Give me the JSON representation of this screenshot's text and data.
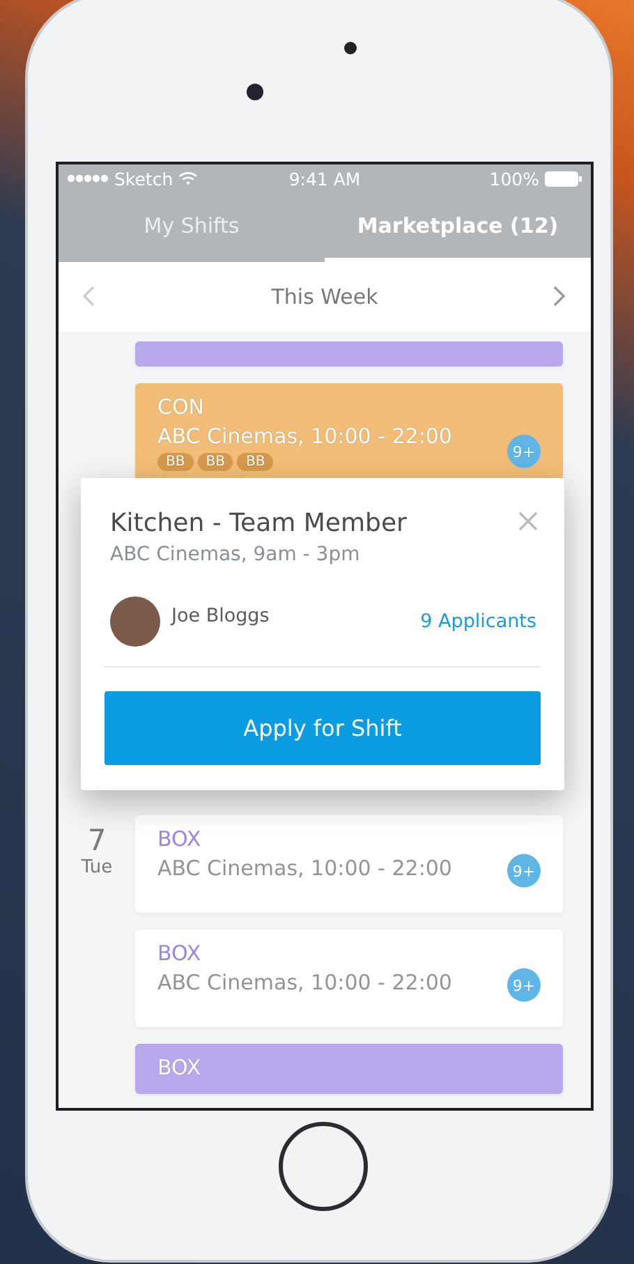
{
  "status_bar": {
    "carrier": "Sketch",
    "time": "9:41 AM",
    "battery": "100%"
  },
  "tabs": [
    {
      "label": "My Shifts",
      "selected": false
    },
    {
      "label": "Marketplace (12)",
      "selected": true
    }
  ],
  "week_header": {
    "title": "This Week"
  },
  "days": [
    {
      "shifts": [
        {
          "kind": "striped",
          "color": "#b9a9ec"
        },
        {
          "kind": "striped",
          "color": "#f2bd78",
          "code": "CON",
          "place_time": "ABC Cinemas, 10:00 - 22:00",
          "badge": "9+",
          "tags": [
            "BB",
            "BB",
            "BB"
          ]
        }
      ]
    },
    {
      "day": "7",
      "weekday": "Tue",
      "shifts": [
        {
          "kind": "plain",
          "color": "#9c88e2",
          "code": "BOX",
          "place_time": "ABC Cinemas, 10:00 - 22:00",
          "badge": "9+"
        },
        {
          "kind": "plain",
          "color": "#9c88e2",
          "code": "BOX",
          "place_time": "ABC Cinemas, 10:00 - 22:00",
          "badge": "9+"
        },
        {
          "kind": "striped",
          "color": "#b9a9ec",
          "code": "BOX"
        }
      ]
    }
  ],
  "popup": {
    "title": "Kitchen - Team Member",
    "subtitle": "ABC Cinemas, 9am - 3pm",
    "person": "Joe Bloggs",
    "applicants": "9 Applicants",
    "button": "Apply for Shift"
  }
}
